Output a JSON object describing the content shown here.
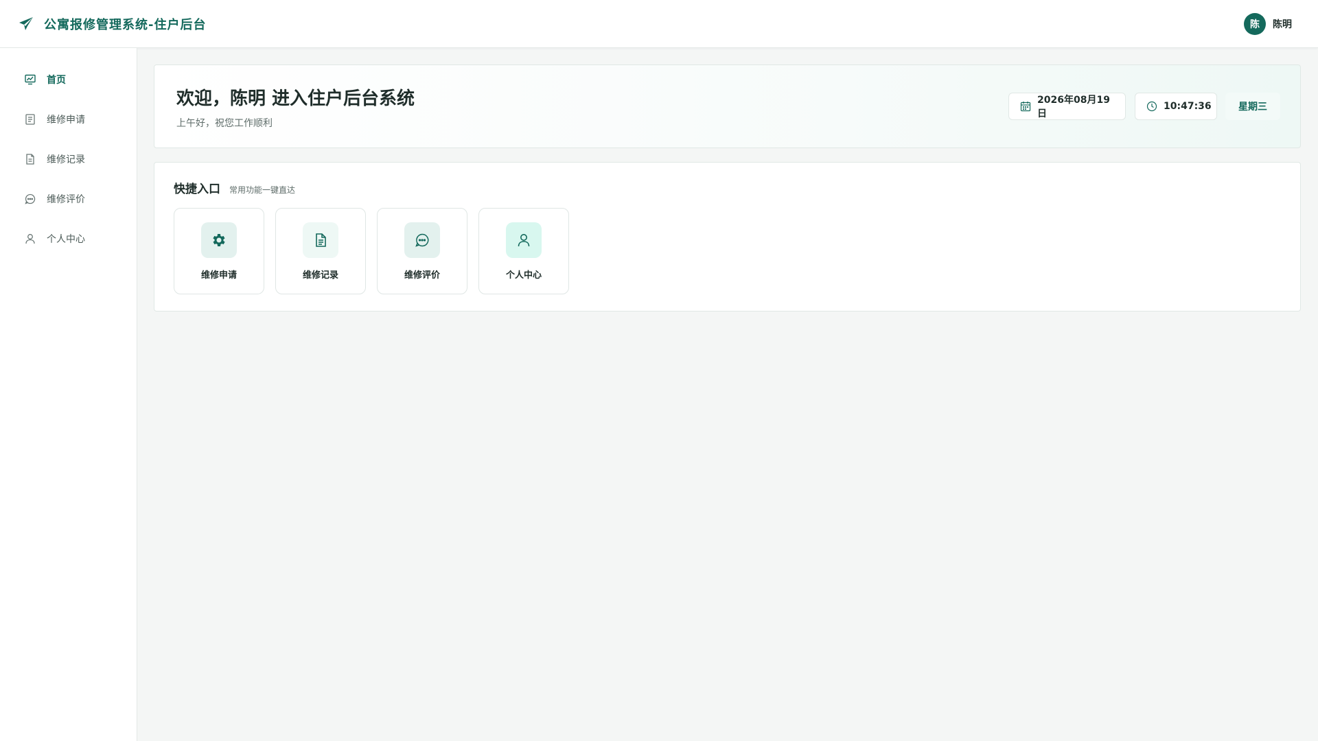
{
  "header": {
    "title": "公寓报修管理系统-住户后台",
    "user": {
      "avatar_text": "陈",
      "name": "陈明"
    }
  },
  "sidebar": {
    "items": [
      {
        "label": "首页",
        "icon": "dashboard-icon",
        "active": true
      },
      {
        "label": "维修申请",
        "icon": "form-icon",
        "active": false
      },
      {
        "label": "维修记录",
        "icon": "document-icon",
        "active": false
      },
      {
        "label": "维修评价",
        "icon": "chat-icon",
        "active": false
      },
      {
        "label": "个人中心",
        "icon": "user-icon",
        "active": false
      }
    ]
  },
  "welcome": {
    "title": "欢迎，陈明 进入住户后台系统",
    "subtitle": "上午好，祝您工作顺利",
    "date": "2026年08月19日",
    "time": "10:47:36",
    "weekday": "星期三"
  },
  "quick": {
    "title": "快捷入口",
    "subtitle": "常用功能一键直达",
    "items": [
      {
        "label": "维修申请",
        "icon": "gear-icon"
      },
      {
        "label": "维修记录",
        "icon": "document-icon"
      },
      {
        "label": "维修评价",
        "icon": "chat-icon"
      },
      {
        "label": "个人中心",
        "icon": "user-icon"
      }
    ]
  },
  "colors": {
    "primary": "#14695c",
    "background": "#f4f6f5",
    "icon_bg_1": "#e3f1ee",
    "icon_bg_2": "#eef8f5",
    "icon_bg_3": "#e3f1ee",
    "icon_bg_4": "#d8f7ef"
  }
}
